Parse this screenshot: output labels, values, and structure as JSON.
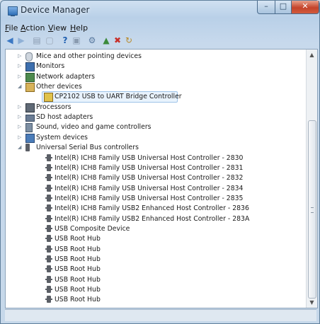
{
  "window": {
    "title": "Device Manager"
  },
  "menu": [
    {
      "label": "File",
      "underline": "F",
      "rest": "ile"
    },
    {
      "label": "Action",
      "underline": "A",
      "rest": "ction"
    },
    {
      "label": "View",
      "underline": "V",
      "rest": "iew"
    },
    {
      "label": "Help",
      "underline": "H",
      "rest": "elp"
    }
  ],
  "toolbar_icons": [
    "back-arrow-icon",
    "forward-arrow-icon",
    "console-tree-icon",
    "properties-icon",
    "help-icon",
    "console-icon",
    "scan-hardware-icon",
    "update-driver-icon",
    "uninstall-icon",
    "disable-icon"
  ],
  "tree": {
    "items": [
      {
        "label": "Mice and other pointing devices",
        "level": 1,
        "expander": "collapsed",
        "icon": "mouse-icon"
      },
      {
        "label": "Monitors",
        "level": 1,
        "expander": "collapsed",
        "icon": "monitor-icon"
      },
      {
        "label": "Network adapters",
        "level": 1,
        "expander": "collapsed",
        "icon": "network-adapter-icon"
      },
      {
        "label": "Other devices",
        "level": 1,
        "expander": "expanded",
        "icon": "other-devices-icon"
      },
      {
        "label": "CP2102 USB to UART Bridge Controller",
        "level": 2,
        "expander": "none",
        "icon": "warning-device-icon",
        "selected": true
      },
      {
        "label": "Processors",
        "level": 1,
        "expander": "collapsed",
        "icon": "processor-icon"
      },
      {
        "label": "SD host adapters",
        "level": 1,
        "expander": "collapsed",
        "icon": "sd-host-icon"
      },
      {
        "label": "Sound, video and game controllers",
        "level": 1,
        "expander": "collapsed",
        "icon": "sound-icon"
      },
      {
        "label": "System devices",
        "level": 1,
        "expander": "collapsed",
        "icon": "system-devices-icon"
      },
      {
        "label": "Universal Serial Bus controllers",
        "level": 1,
        "expander": "expanded",
        "icon": "usb-controller-icon"
      },
      {
        "label": "Intel(R) ICH8 Family USB Universal Host Controller - 2830",
        "level": 2,
        "expander": "none",
        "icon": "usb-plug-icon"
      },
      {
        "label": "Intel(R) ICH8 Family USB Universal Host Controller - 2831",
        "level": 2,
        "expander": "none",
        "icon": "usb-plug-icon"
      },
      {
        "label": "Intel(R) ICH8 Family USB Universal Host Controller - 2832",
        "level": 2,
        "expander": "none",
        "icon": "usb-plug-icon"
      },
      {
        "label": "Intel(R) ICH8 Family USB Universal Host Controller - 2834",
        "level": 2,
        "expander": "none",
        "icon": "usb-plug-icon"
      },
      {
        "label": "Intel(R) ICH8 Family USB Universal Host Controller - 2835",
        "level": 2,
        "expander": "none",
        "icon": "usb-plug-icon"
      },
      {
        "label": "Intel(R) ICH8 Family USB2 Enhanced Host Controller - 2836",
        "level": 2,
        "expander": "none",
        "icon": "usb-plug-icon"
      },
      {
        "label": "Intel(R) ICH8 Family USB2 Enhanced Host Controller - 283A",
        "level": 2,
        "expander": "none",
        "icon": "usb-plug-icon"
      },
      {
        "label": "USB Composite Device",
        "level": 2,
        "expander": "none",
        "icon": "usb-plug-icon"
      },
      {
        "label": "USB Root Hub",
        "level": 2,
        "expander": "none",
        "icon": "usb-plug-icon"
      },
      {
        "label": "USB Root Hub",
        "level": 2,
        "expander": "none",
        "icon": "usb-plug-icon"
      },
      {
        "label": "USB Root Hub",
        "level": 2,
        "expander": "none",
        "icon": "usb-plug-icon"
      },
      {
        "label": "USB Root Hub",
        "level": 2,
        "expander": "none",
        "icon": "usb-plug-icon"
      },
      {
        "label": "USB Root Hub",
        "level": 2,
        "expander": "none",
        "icon": "usb-plug-icon"
      },
      {
        "label": "USB Root Hub",
        "level": 2,
        "expander": "none",
        "icon": "usb-plug-icon"
      },
      {
        "label": "USB Root Hub",
        "level": 2,
        "expander": "none",
        "icon": "usb-plug-icon"
      }
    ]
  }
}
